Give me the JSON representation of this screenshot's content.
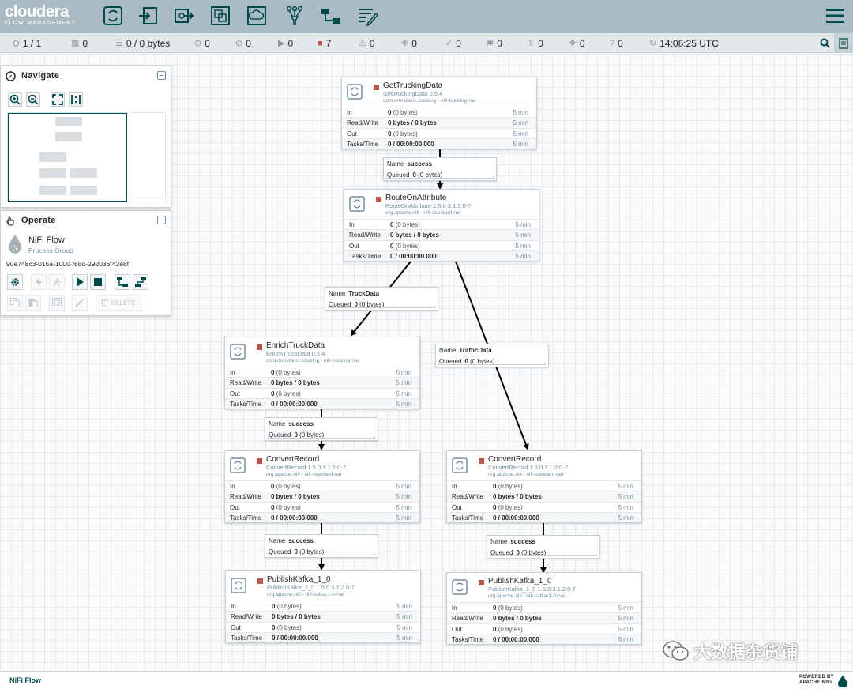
{
  "header": {
    "logo_main": "cloudera",
    "logo_sub": "FLOW MANAGEMENT",
    "tools": [
      "processor-icon",
      "input-port-icon",
      "output-port-icon",
      "process-group-icon",
      "remote-process-group-icon",
      "funnel-icon",
      "template-icon",
      "label-icon"
    ],
    "menu_icon": "hamburger-menu-icon"
  },
  "status": {
    "cluster": "1 / 1",
    "threads": "0",
    "queued": "0 / 0 bytes",
    "transmitting": "0",
    "not_transmitting": "0",
    "running": "0",
    "stopped": "7",
    "invalid": "0",
    "disabled": "0",
    "up_to_date": "0",
    "locally_modified": "0",
    "stale": "0",
    "locally_modified_stale": "0",
    "sync_failure": "0",
    "refresh_time": "14:06:25 UTC"
  },
  "navigate": {
    "title": "Navigate"
  },
  "operate": {
    "title": "Operate",
    "name": "NiFi Flow",
    "type": "Process Group",
    "id": "90e748c3-015a-1000-f68d-292036f42e8f",
    "delete_label": "DELETE"
  },
  "labels": {
    "in": "In",
    "rw": "Read/Write",
    "out": "Out",
    "tasks": "Tasks/Time",
    "five_min": "5 min",
    "name": "Name",
    "queued": "Queued"
  },
  "processors": [
    {
      "name": "GetTruckingData",
      "type": "GetTruckingData 0.5.4",
      "bundle": "com.orendainx.trucking - nifi-trucking-nar",
      "in_val": "0",
      "in_size": "(0 bytes)",
      "rw": "0 bytes / 0 bytes",
      "out_val": "0",
      "out_size": "(0 bytes)",
      "tasks": "0 / 00:00:00.000"
    },
    {
      "name": "RouteOnAttribute",
      "type": "RouteOnAttribute 1.5.0.3.1.2.0-7",
      "bundle": "org.apache.nifi - nifi-standard-nar",
      "in_val": "0",
      "in_size": "(0 bytes)",
      "rw": "0 bytes / 0 bytes",
      "out_val": "0",
      "out_size": "(0 bytes)",
      "tasks": "0 / 00:00:00.000"
    },
    {
      "name": "EnrichTruckData",
      "type": "EnrichTruckData 0.5.4",
      "bundle": "com.orendainx.trucking - nifi-trucking-nar",
      "in_val": "0",
      "in_size": "(0 bytes)",
      "rw": "0 bytes / 0 bytes",
      "out_val": "0",
      "out_size": "(0 bytes)",
      "tasks": "0 / 00:00:00.000"
    },
    {
      "name": "ConvertRecord",
      "type": "ConvertRecord 1.5.0.3.1.2.0-7",
      "bundle": "org.apache.nifi - nifi-standard-nar",
      "in_val": "0",
      "in_size": "(0 bytes)",
      "rw": "0 bytes / 0 bytes",
      "out_val": "0",
      "out_size": "(0 bytes)",
      "tasks": "0 / 00:00:00.000"
    },
    {
      "name": "ConvertRecord",
      "type": "ConvertRecord 1.5.0.3.1.2.0-7",
      "bundle": "org.apache.nifi - nifi-standard-nar",
      "in_val": "0",
      "in_size": "(0 bytes)",
      "rw": "0 bytes / 0 bytes",
      "out_val": "0",
      "out_size": "(0 bytes)",
      "tasks": "0 / 00:00:00.000"
    },
    {
      "name": "PublishKafka_1_0",
      "type": "PublishKafka_1_0 1.5.0.3.1.2.0-7",
      "bundle": "org.apache.nifi - nifi-kafka-1-0-nar",
      "in_val": "0",
      "in_size": "(0 bytes)",
      "rw": "0 bytes / 0 bytes",
      "out_val": "0",
      "out_size": "(0 bytes)",
      "tasks": "0 / 00:00:00.000"
    },
    {
      "name": "PublishKafka_1_0",
      "type": "PublishKafka_1_0 1.5.0.3.1.2.0-7",
      "bundle": "org.apache.nifi - nifi-kafka-1-0-nar",
      "in_val": "0",
      "in_size": "(0 bytes)",
      "rw": "0 bytes / 0 bytes",
      "out_val": "0",
      "out_size": "(0 bytes)",
      "tasks": "0 / 00:00:00.000"
    }
  ],
  "connections": [
    {
      "name": "success",
      "queued_val": "0",
      "queued_size": "(0 bytes)"
    },
    {
      "name": "TruckData",
      "queued_val": "0",
      "queued_size": "(0 bytes)"
    },
    {
      "name": "TrafficData",
      "queued_val": "0",
      "queued_size": "(0 bytes)"
    },
    {
      "name": "success",
      "queued_val": "0",
      "queued_size": "(0 bytes)"
    },
    {
      "name": "success",
      "queued_val": "0",
      "queued_size": "(0 bytes)"
    },
    {
      "name": "success",
      "queued_val": "0",
      "queued_size": "(0 bytes)"
    }
  ],
  "footer": {
    "breadcrumb": "NiFi Flow",
    "powered_line1": "POWERED BY",
    "powered_line2": "APACHE NIFI",
    "watermark": "大数据杂货铺"
  },
  "colors": {
    "header_bg": "#aabbc3",
    "accent": "#004849",
    "stopped": "#ba554a",
    "muted": "#728e9b"
  }
}
